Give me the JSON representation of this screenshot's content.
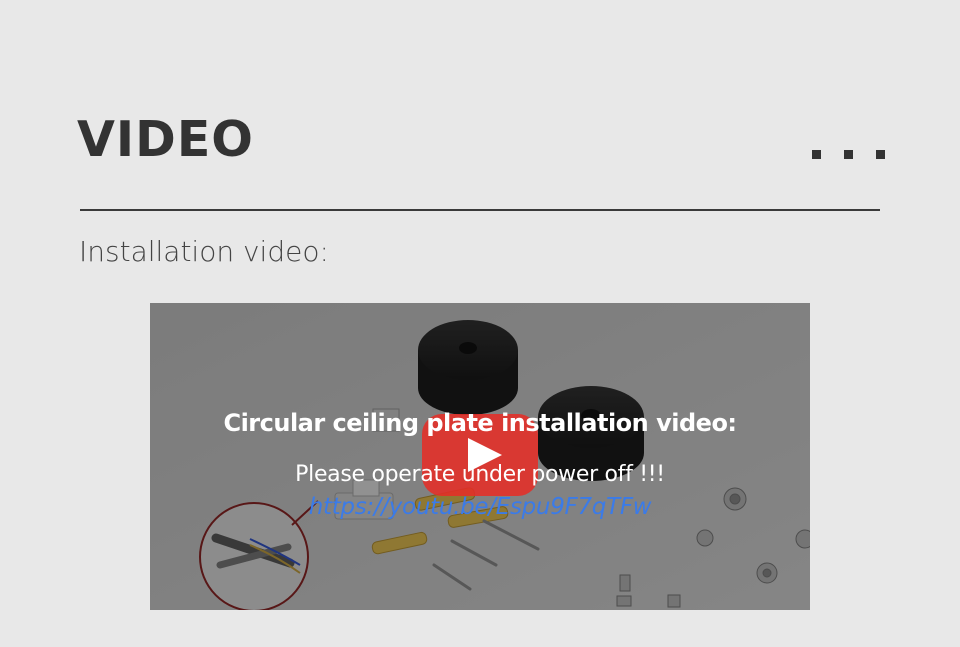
{
  "section": {
    "title": "VIDEO",
    "subtitle": "Installation video:"
  },
  "video": {
    "heading": "Circular ceiling plate installation video:",
    "note": "Please operate under power off !!!",
    "link_text": "https://youtu.be/Espu9F7qTFw"
  },
  "icons": {
    "menu": "more-dots-icon",
    "play": "youtube-play-icon"
  },
  "colors": {
    "background": "#e8e8e8",
    "title": "#333333",
    "link": "#3b7be8",
    "play_red": "#e52d27"
  }
}
